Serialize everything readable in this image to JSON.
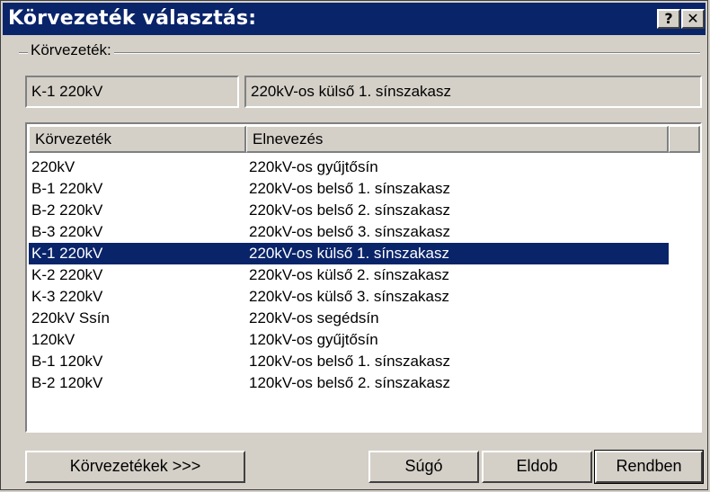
{
  "window": {
    "title": "Körvezeték választás:",
    "help_glyph": "?",
    "close_glyph": "✕"
  },
  "group": {
    "label": "Körvezeték:",
    "selected_code": "K-1 220kV",
    "selected_name": "220kV-os külső 1. sínszakasz"
  },
  "list": {
    "columns": [
      "Körvezeték",
      "Elnevezés"
    ],
    "rows": [
      {
        "code": "220kV",
        "name": "220kV-os gyűjtősín"
      },
      {
        "code": "B-1 220kV",
        "name": "220kV-os belső 1. sínszakasz"
      },
      {
        "code": "B-2 220kV",
        "name": "220kV-os belső 2. sínszakasz"
      },
      {
        "code": "B-3 220kV",
        "name": "220kV-os belső 3. sínszakasz"
      },
      {
        "code": "K-1 220kV",
        "name": "220kV-os külső 1. sínszakasz",
        "selected": true
      },
      {
        "code": "K-2 220kV",
        "name": "220kV-os külső 2. sínszakasz"
      },
      {
        "code": "K-3 220kV",
        "name": "220kV-os külső 3. sínszakasz"
      },
      {
        "code": "220kV Ssín",
        "name": "220kV-os segédsín"
      },
      {
        "code": "120kV",
        "name": "120kV-os gyűjtősín"
      },
      {
        "code": "B-1 120kV",
        "name": "120kV-os belső 1. sínszakasz"
      },
      {
        "code": "B-2 120kV",
        "name": "120kV-os belső 2. sínszakasz"
      }
    ]
  },
  "buttons": {
    "korvezetekek": "Körvezetékek >>>",
    "sugo": "Súgó",
    "eldob": "Eldob",
    "rendben": "Rendben"
  },
  "colors": {
    "titlebar": "#0a246a",
    "face": "#d4d0c8",
    "selection": "#0a246a"
  }
}
